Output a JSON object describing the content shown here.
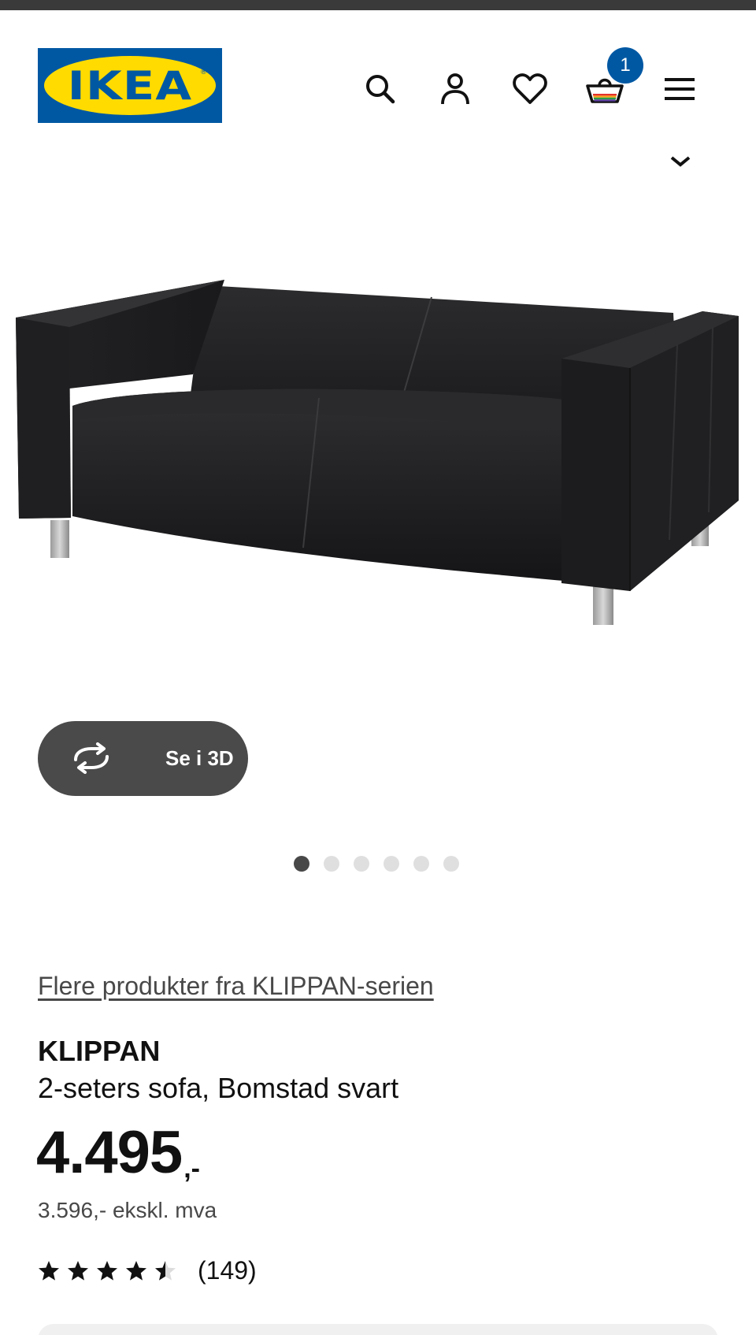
{
  "header": {
    "logo_text": "IKEA",
    "logo_registered": "®",
    "cart_count": "1"
  },
  "gallery": {
    "view3d_label": "Se i 3D",
    "dot_count": 6,
    "active_index": 0
  },
  "product": {
    "series_link": "Flere produkter fra KLIPPAN-serien",
    "name": "KLIPPAN",
    "description": "2-seters sofa, Bomstad svart",
    "price_integer": "4.495",
    "price_suffix": ",-",
    "price_ex_vat": "3.596,- ekskl. mva",
    "rating_value": 4.5,
    "rating_max": 5,
    "rating_count": "(149)"
  },
  "colors": {
    "brand_blue": "#0058a3",
    "brand_yellow": "#ffdb00",
    "button_dark": "#4a4a4a"
  }
}
